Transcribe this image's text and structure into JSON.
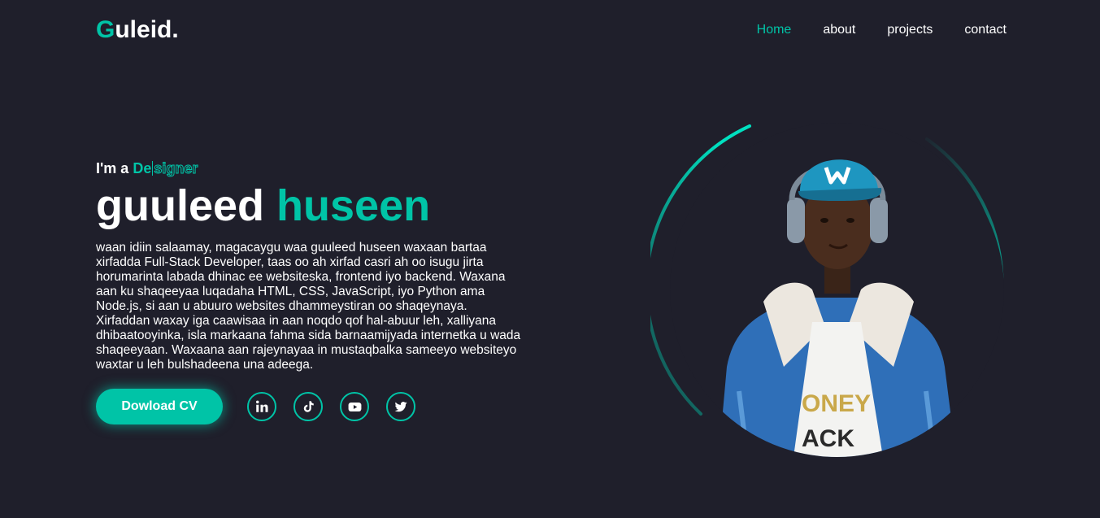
{
  "header": {
    "logo_first": "G",
    "logo_rest": "uleid."
  },
  "nav": {
    "items": [
      "Home",
      "about",
      "projects",
      "contact"
    ],
    "active": "Home"
  },
  "hero": {
    "tagline_prefix": "I'm a",
    "typed_solid": "De",
    "typed_ghost": "signer",
    "name_first": "guuleed",
    "name_last": "huseen",
    "bio": "waan idiin salaamay, magacaygu waa guuleed huseen waxaan bartaa xirfadda Full-Stack Developer, taas oo ah xirfad casri ah oo isugu jirta horumarinta labada dhinac ee websiteska, frontend iyo backend. Waxana aan ku shaqeeyaa luqadaha HTML, CSS, JavaScript, iyo Python ama Node.js, si aan u abuuro websites dhammeystiran oo shaqeynaya. Xirfaddan waxay iga caawisaa in aan noqdo qof hal-abuur leh, xalliyana dhibaatooyinka, isla markaana fahma sida barnaamijyada internetka u wada shaqeeyaan. Waxaana aan rajeynayaa in mustaqbalka sameeyo websiteyo waxtar u leh bulshadeena una adeega.",
    "cv_button": "Dowload CV"
  },
  "socials": [
    "linkedin-icon",
    "tiktok-icon",
    "youtube-icon",
    "twitter-icon"
  ],
  "colors": {
    "accent": "#00c4a7",
    "background": "#1f1f2b",
    "text": "#ffffff"
  }
}
